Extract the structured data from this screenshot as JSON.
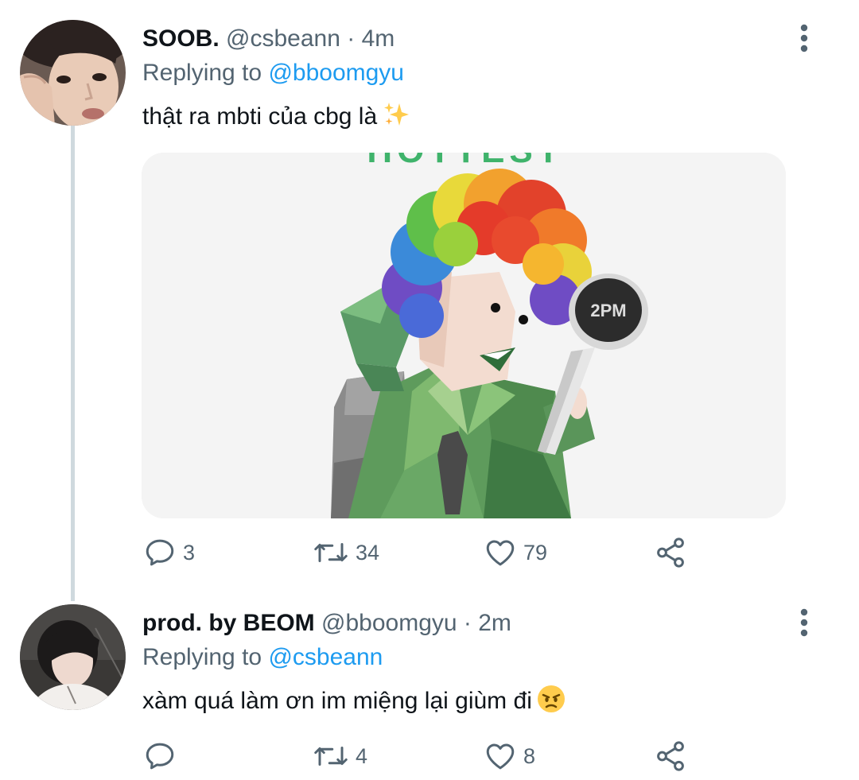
{
  "tweet1": {
    "name": "SOOB.",
    "handle": "@csbeann",
    "time": "· 4m",
    "replying_prefix": "Replying to",
    "replying_to": "@bboomgyu",
    "text": "thật ra mbti của cbg là",
    "text_emoji": "sparkles-icon",
    "media_caption": "HOTTEST",
    "lightstick_text": "2PM",
    "replies": "3",
    "retweets": "34",
    "likes": "79"
  },
  "tweet2": {
    "name": "prod. by BEOM",
    "handle": "@bboomgyu",
    "time": "· 2m",
    "replying_prefix": "Replying to",
    "replying_to": "@csbeann",
    "text": "xàm quá làm ơn im miệng lại giùm đi",
    "text_emoji": "angry-face-icon",
    "replies": "",
    "retweets": "4",
    "likes": "8"
  },
  "colors": {
    "text": "#0f1419",
    "secondary": "#536471",
    "link": "#1d9bf0",
    "thread_line": "#cfd9de",
    "media_caption": "#3fb36b"
  }
}
